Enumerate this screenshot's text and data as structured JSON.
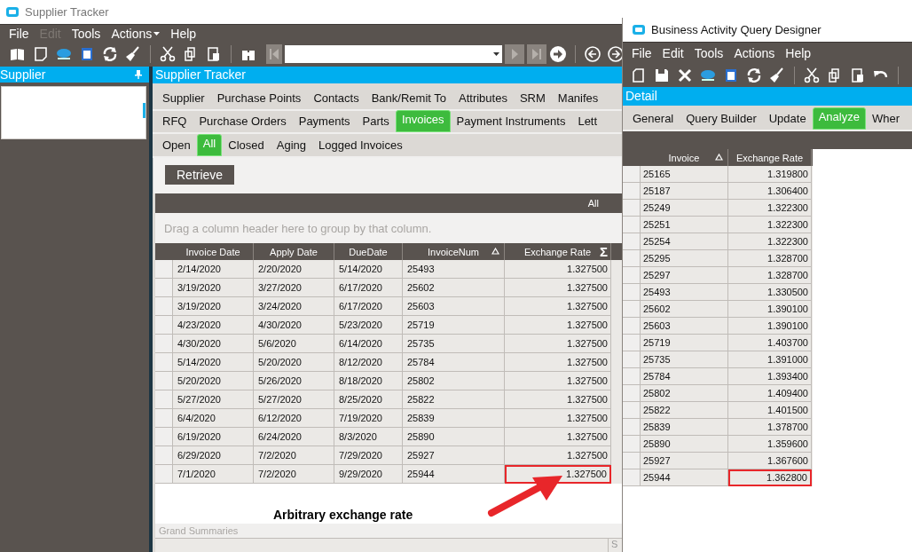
{
  "main_window": {
    "title": "Supplier Tracker",
    "menu": [
      {
        "label": "File",
        "disabled": false,
        "dropdown": false
      },
      {
        "label": "Edit",
        "disabled": true,
        "dropdown": false
      },
      {
        "label": "Tools",
        "disabled": false,
        "dropdown": false
      },
      {
        "label": "Actions",
        "disabled": false,
        "dropdown": true
      },
      {
        "label": "Help",
        "disabled": false,
        "dropdown": false
      }
    ],
    "side_panel": {
      "title": "Supplier"
    },
    "panel": {
      "title": "Supplier Tracker"
    },
    "tab_rows": [
      [
        {
          "label": "Supplier",
          "selected": false
        },
        {
          "label": "Purchase Points",
          "selected": false
        },
        {
          "label": "Contacts",
          "selected": false
        },
        {
          "label": "Bank/Remit To",
          "selected": false
        },
        {
          "label": "Attributes",
          "selected": false
        },
        {
          "label": "SRM",
          "selected": false
        },
        {
          "label": "Manifes",
          "selected": false
        }
      ],
      [
        {
          "label": "RFQ",
          "selected": false
        },
        {
          "label": "Purchase Orders",
          "selected": false
        },
        {
          "label": "Payments",
          "selected": false
        },
        {
          "label": "Parts",
          "selected": false
        },
        {
          "label": "Invoices",
          "selected": true
        },
        {
          "label": "Payment Instruments",
          "selected": false
        },
        {
          "label": "Lett",
          "selected": false
        }
      ],
      [
        {
          "label": "Open",
          "selected": false
        },
        {
          "label": "All",
          "selected": true
        },
        {
          "label": "Closed",
          "selected": false
        },
        {
          "label": "Aging",
          "selected": false
        },
        {
          "label": "Logged Invoices",
          "selected": false
        }
      ]
    ],
    "retrieve_button": "Retrieve",
    "grid": {
      "band_label": "All",
      "group_hint": "Drag a column header here to group by that column.",
      "columns": [
        {
          "label": "Invoice Date",
          "sorted": false
        },
        {
          "label": "Apply Date",
          "sorted": false
        },
        {
          "label": "DueDate",
          "sorted": false
        },
        {
          "label": "InvoiceNum",
          "sorted": true
        },
        {
          "label": "Exchange Rate",
          "sorted": false,
          "summary_symbol": "Σ"
        }
      ],
      "rows": [
        {
          "cells": [
            "2/14/2020",
            "2/20/2020",
            "5/14/2020",
            "25493",
            "1.327500"
          ],
          "marked": false
        },
        {
          "cells": [
            "3/19/2020",
            "3/27/2020",
            "6/17/2020",
            "25602",
            "1.327500"
          ],
          "marked": false
        },
        {
          "cells": [
            "3/19/2020",
            "3/24/2020",
            "6/17/2020",
            "25603",
            "1.327500"
          ],
          "marked": false
        },
        {
          "cells": [
            "4/23/2020",
            "4/30/2020",
            "5/23/2020",
            "25719",
            "1.327500"
          ],
          "marked": false
        },
        {
          "cells": [
            "4/30/2020",
            "5/6/2020",
            "6/14/2020",
            "25735",
            "1.327500"
          ],
          "marked": false
        },
        {
          "cells": [
            "5/14/2020",
            "5/20/2020",
            "8/12/2020",
            "25784",
            "1.327500"
          ],
          "marked": false
        },
        {
          "cells": [
            "5/20/2020",
            "5/26/2020",
            "8/18/2020",
            "25802",
            "1.327500"
          ],
          "marked": false
        },
        {
          "cells": [
            "5/27/2020",
            "5/27/2020",
            "8/25/2020",
            "25822",
            "1.327500"
          ],
          "marked": false
        },
        {
          "cells": [
            "6/4/2020",
            "6/12/2020",
            "7/19/2020",
            "25839",
            "1.327500"
          ],
          "marked": false
        },
        {
          "cells": [
            "6/19/2020",
            "6/24/2020",
            "8/3/2020",
            "25890",
            "1.327500"
          ],
          "marked": false
        },
        {
          "cells": [
            "6/29/2020",
            "7/2/2020",
            "7/29/2020",
            "25927",
            "1.327500"
          ],
          "marked": false
        },
        {
          "cells": [
            "7/1/2020",
            "7/2/2020",
            "9/29/2020",
            "25944",
            "1.327500"
          ],
          "marked": true
        }
      ]
    },
    "annotation": "Arbitrary exchange rate",
    "grand_summaries": {
      "label": "Grand Summaries",
      "column_1": "S"
    }
  },
  "query_window": {
    "title": "Business Activity Query Designer",
    "menu": [
      {
        "label": "File",
        "disabled": false,
        "dropdown": false
      },
      {
        "label": "Edit",
        "disabled": false,
        "dropdown": false
      },
      {
        "label": "Tools",
        "disabled": false,
        "dropdown": false
      },
      {
        "label": "Actions",
        "disabled": false,
        "dropdown": false
      },
      {
        "label": "Help",
        "disabled": false,
        "dropdown": false
      }
    ],
    "panel": {
      "title": "Detail"
    },
    "tabs": [
      {
        "label": "General",
        "selected": false
      },
      {
        "label": "Query Builder",
        "selected": false
      },
      {
        "label": "Update",
        "selected": false
      },
      {
        "label": "Analyze",
        "selected": true
      },
      {
        "label": "Wher",
        "selected": false
      }
    ],
    "grid": {
      "columns": [
        {
          "label": "Invoice",
          "sorted": true
        },
        {
          "label": "Exchange Rate",
          "sorted": false
        }
      ],
      "rows": [
        {
          "cells": [
            "25165",
            "1.319800"
          ],
          "marked": false
        },
        {
          "cells": [
            "25187",
            "1.306400"
          ],
          "marked": false
        },
        {
          "cells": [
            "25249",
            "1.322300"
          ],
          "marked": false
        },
        {
          "cells": [
            "25251",
            "1.322300"
          ],
          "marked": false
        },
        {
          "cells": [
            "25254",
            "1.322300"
          ],
          "marked": false
        },
        {
          "cells": [
            "25295",
            "1.328700"
          ],
          "marked": false
        },
        {
          "cells": [
            "25297",
            "1.328700"
          ],
          "marked": false
        },
        {
          "cells": [
            "25493",
            "1.330500"
          ],
          "marked": false
        },
        {
          "cells": [
            "25602",
            "1.390100"
          ],
          "marked": false
        },
        {
          "cells": [
            "25603",
            "1.390100"
          ],
          "marked": false
        },
        {
          "cells": [
            "25719",
            "1.403700"
          ],
          "marked": false
        },
        {
          "cells": [
            "25735",
            "1.391000"
          ],
          "marked": false
        },
        {
          "cells": [
            "25784",
            "1.393400"
          ],
          "marked": false
        },
        {
          "cells": [
            "25802",
            "1.409400"
          ],
          "marked": false
        },
        {
          "cells": [
            "25822",
            "1.401500"
          ],
          "marked": false
        },
        {
          "cells": [
            "25839",
            "1.378700"
          ],
          "marked": false
        },
        {
          "cells": [
            "25890",
            "1.359600"
          ],
          "marked": false
        },
        {
          "cells": [
            "25927",
            "1.367600"
          ],
          "marked": false
        },
        {
          "cells": [
            "25944",
            "1.362800"
          ],
          "marked": true
        }
      ]
    }
  }
}
